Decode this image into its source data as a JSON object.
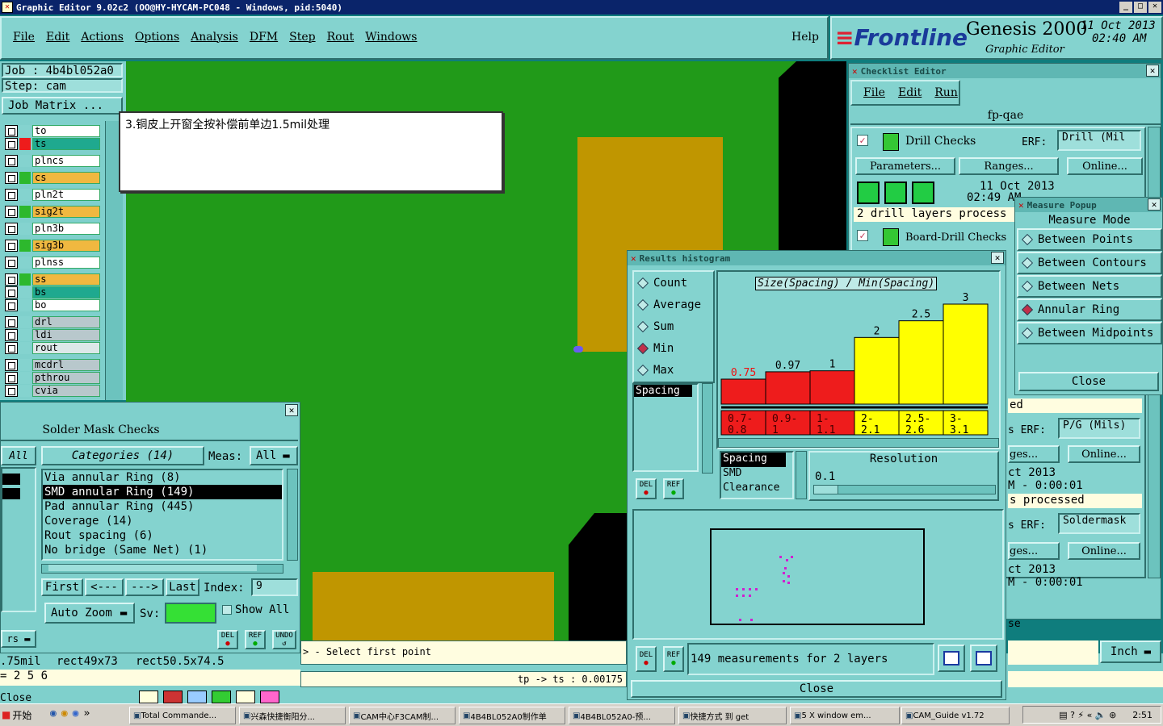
{
  "window": {
    "title": "Graphic Editor 9.02c2  (OO@HY-HYCAM-PC048 - Windows, pid:5040)"
  },
  "menu": [
    "File",
    "Edit",
    "Actions",
    "Options",
    "Analysis",
    "DFM",
    "Step",
    "Rout",
    "Windows"
  ],
  "help": "Help",
  "brand": {
    "logo": "Frontline",
    "product": "Genesis 2000",
    "subtitle": "Graphic Editor",
    "date": "11 Oct 2013",
    "time": "02:40 AM"
  },
  "job": {
    "job_label": "Job : 4b4bl052a0",
    "step_label": "Step: cam",
    "matrix_button": "Job Matrix ..."
  },
  "layers": [
    {
      "name": "to",
      "color": "#ffffff"
    },
    {
      "name": "ts",
      "color": "#1fa98f"
    },
    {
      "name": "plncs",
      "color": "#ffffff"
    },
    {
      "name": "cs",
      "color": "#f0b840"
    },
    {
      "name": "pln2t",
      "color": "#ffffff"
    },
    {
      "name": "sig2t",
      "color": "#f0b840"
    },
    {
      "name": "pln3b",
      "color": "#ffffff"
    },
    {
      "name": "sig3b",
      "color": "#f0b840"
    },
    {
      "name": "plnss",
      "color": "#ffffff"
    },
    {
      "name": "ss",
      "color": "#f0b840"
    },
    {
      "name": "bs",
      "color": "#1fa98f"
    },
    {
      "name": "bo",
      "color": "#ffffff"
    },
    {
      "name": "drl",
      "color": "#b8c8cc"
    },
    {
      "name": "ldi",
      "color": "#b8c8cc"
    },
    {
      "name": "rout",
      "color": "#dce8e8"
    },
    {
      "name": "mcdrl",
      "color": "#b8c8cc"
    },
    {
      "name": "pthrou",
      "color": "#b8c8cc"
    },
    {
      "name": "cvia",
      "color": "#b8c8cc"
    }
  ],
  "note": "3.铜皮上开窗全按补偿前单边1.5mil处理",
  "solder": {
    "title": "Solder Mask Checks",
    "all_tab": "All",
    "categories_label": "Categories (14)",
    "meas_label": "Meas:",
    "meas_value": "All",
    "items": [
      "Via annular Ring (8)",
      "SMD annular Ring (149)",
      "Pad annular Ring (445)",
      "Coverage (14)",
      "Rout spacing (6)",
      "No bridge (Same Net) (1)"
    ],
    "selected_index": 1,
    "nav": {
      "first": "First",
      "prev": "<---",
      "next": "--->",
      "last": "Last",
      "index_label": "Index:",
      "index_value": "9"
    },
    "auto_zoom": "Auto Zoom",
    "sv_label": "Sv:",
    "show_all": "Show All",
    "del": "DEL",
    "ref": "REF",
    "undo": "UNDO"
  },
  "status": {
    "left1": ".75mil",
    "rect1": "rect49x73",
    "rect2": "rect50.5x74.5",
    "left2": "= 2 5 6",
    "prompt": "> - Select first point",
    "tp": "tp -> ts : 0.00175",
    "close_left": "Close",
    "units": "Inch"
  },
  "checklist": {
    "title": "Checklist Editor",
    "menu": [
      "File",
      "Edit",
      "Run"
    ],
    "name": "fp-qae",
    "drill_checks": "Drill Checks",
    "erf_label": "ERF:",
    "erf_value": "Drill (Mil",
    "parameters": "Parameters...",
    "ranges": "Ranges...",
    "online": "Online...",
    "date": "11 Oct 2013",
    "time": "02:49 AM",
    "processed": "2 drill layers process",
    "board_drill": "Board-Drill Checks",
    "ed": "ed",
    "erf2": "P/G (Mils)",
    "ges1": "ges...",
    "online2": "Online...",
    "date2": "ct 2013",
    "dur2": "M - 0:00:01",
    "processed2": "s processed",
    "erf3": "Soldermask",
    "ges2": "ges...",
    "online3": "Online...",
    "date3": "ct 2013",
    "dur3": "M - 0:00:01",
    "se": "se"
  },
  "measure": {
    "title": "Measure Popup",
    "mode_label": "Measure Mode",
    "options": [
      "Between Points",
      "Between Contours",
      "Between Nets",
      "Annular Ring",
      "Between Midpoints"
    ],
    "selected": 3,
    "close": "Close"
  },
  "histogram": {
    "title": "Results histogram",
    "stats": [
      "Count",
      "Average",
      "Sum",
      "Min",
      "Max"
    ],
    "selected_stat": 3,
    "list_item": "Spacing",
    "chart_title": "Size(Spacing) / Min(Spacing)",
    "bins": [
      "0.7- 0.8",
      "0.9- 1",
      "1- 1.1",
      "2- 2.1",
      "2.5- 2.6",
      "3- 3.1"
    ],
    "attrs": [
      "Spacing",
      "SMD",
      "Clearance"
    ],
    "resolution_label": "Resolution",
    "resolution_value": "0.1",
    "summary": "149 measurements for 2 layers",
    "close": "Close",
    "del": "DEL",
    "ref": "REF"
  },
  "chart_data": {
    "type": "bar",
    "title": "Size(Spacing) / Min(Spacing)",
    "categories": [
      "0.7-0.8",
      "0.9-1",
      "1-1.1",
      "2-2.1",
      "2.5-2.6",
      "3-3.1"
    ],
    "values": [
      0.75,
      0.97,
      1,
      2,
      2.5,
      3
    ],
    "colors": [
      "#ee1c1c",
      "#ee1c1c",
      "#ee1c1c",
      "#ffff00",
      "#ffff00",
      "#ffff00"
    ],
    "ylim": [
      0,
      3
    ]
  },
  "taskbar": {
    "start": "开始",
    "items": [
      "Total Commande...",
      "兴森快捷衡阳分...",
      "CAM中心F3CAM制...",
      "4B4BL052A0制作单",
      "4B4BL052A0-预...",
      "快捷方式 到 get",
      "5 X window em...",
      "CAM_Guide v1.72"
    ],
    "clock": "2:51"
  },
  "colors": {
    "board_green": "#219a19",
    "copper": "#c09600",
    "teal": "#84d3cf"
  }
}
